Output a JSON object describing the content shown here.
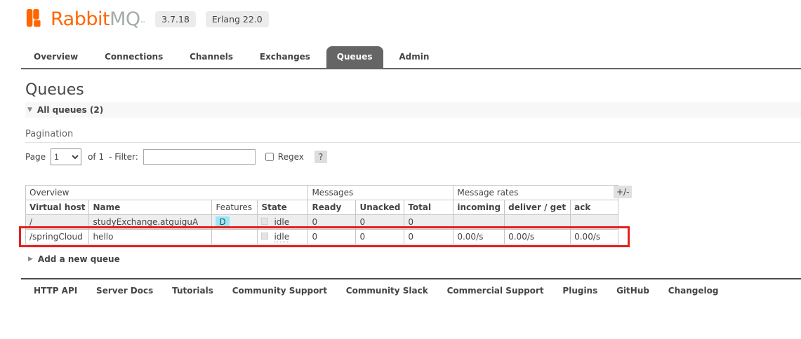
{
  "header": {
    "brand_rabbit": "Rabbit",
    "brand_mq": "MQ",
    "trademark": "™",
    "version_badge": "3.7.18",
    "erlang_badge": "Erlang 22.0"
  },
  "tabs": [
    {
      "label": "Overview",
      "active": false
    },
    {
      "label": "Connections",
      "active": false
    },
    {
      "label": "Channels",
      "active": false
    },
    {
      "label": "Exchanges",
      "active": false
    },
    {
      "label": "Queues",
      "active": true
    },
    {
      "label": "Admin",
      "active": false
    }
  ],
  "page": {
    "title": "Queues",
    "section_toggle_label": "All queues (2)"
  },
  "pagination": {
    "heading": "Pagination",
    "page_label": "Page",
    "page_value": "1",
    "of_label": "of 1",
    "filter_label": "- Filter:",
    "filter_value": "",
    "regex_label": "Regex",
    "help_badge": "?"
  },
  "table": {
    "group_headers": [
      "Overview",
      "Messages",
      "Message rates"
    ],
    "plusminus_label": "+/-",
    "columns": [
      "Virtual host",
      "Name",
      "Features",
      "State",
      "Ready",
      "Unacked",
      "Total",
      "incoming",
      "deliver / get",
      "ack"
    ],
    "rows": [
      {
        "vhost": "/",
        "name": "studyExchange.atguiguA",
        "features": "D",
        "state": "idle",
        "ready": "0",
        "unacked": "0",
        "total": "0",
        "incoming": "",
        "deliver_get": "",
        "ack": ""
      },
      {
        "vhost": "/springCloud",
        "name": "hello",
        "features": "",
        "state": "idle",
        "ready": "0",
        "unacked": "0",
        "total": "0",
        "incoming": "0.00/s",
        "deliver_get": "0.00/s",
        "ack": "0.00/s"
      }
    ],
    "highlighted_row_index": 1
  },
  "add_queue_label": "Add a new queue",
  "footer": {
    "links": [
      "HTTP API",
      "Server Docs",
      "Tutorials",
      "Community Support",
      "Community Slack",
      "Commercial Support",
      "Plugins",
      "GitHub",
      "Changelog"
    ]
  },
  "colors": {
    "brand_orange": "#ff6600",
    "brand_gray": "#a5aba5",
    "active_tab_bg": "#656565",
    "highlight_red": "#e4201e",
    "feature_badge_bg": "#99e8f9",
    "alt_row_bg": "#eeeeee"
  }
}
